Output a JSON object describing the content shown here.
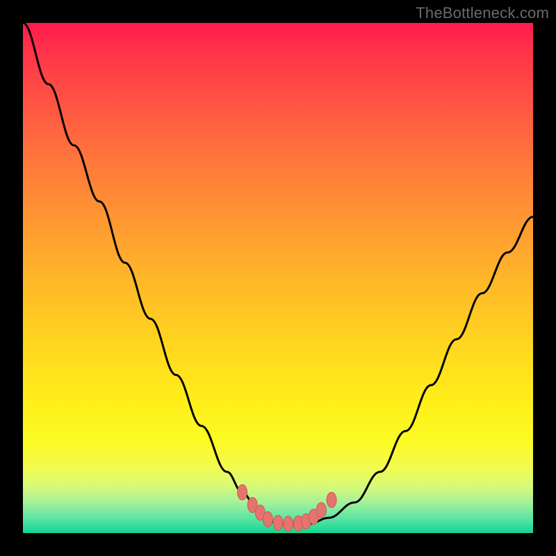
{
  "watermark": "TheBottleneck.com",
  "colors": {
    "frame": "#000000",
    "curve_stroke": "#000000",
    "marker_fill": "#e5746e",
    "marker_stroke": "#c95a54",
    "gradient_stops": [
      "#ff1a4d",
      "#ff3149",
      "#ff5543",
      "#ff7a3a",
      "#ff9b31",
      "#ffbb27",
      "#ffd81f",
      "#fff01a",
      "#fcfa24",
      "#f2fb4e",
      "#d6f97b",
      "#a4f19a",
      "#5fe5a4",
      "#11d692"
    ]
  },
  "chart_data": {
    "type": "line",
    "title": "",
    "xlabel": "",
    "ylabel": "",
    "xlim": [
      0,
      100
    ],
    "ylim": [
      0,
      100
    ],
    "grid": false,
    "legend": "none",
    "annotations": [
      "TheBottleneck.com"
    ],
    "note": "Axes unlabeled in image; x maps to horizontal position (0..100), y to vertical height above bottom (0..100). Values estimated from pixel positions.",
    "series": [
      {
        "name": "curve",
        "x": [
          0,
          5,
          10,
          15,
          20,
          25,
          30,
          35,
          40,
          43,
          46,
          48,
          50,
          52,
          54,
          56,
          60,
          65,
          70,
          75,
          80,
          85,
          90,
          95,
          100
        ],
        "y": [
          100,
          88,
          76,
          65,
          53,
          42,
          31,
          21,
          12,
          8,
          4.5,
          2.5,
          1.8,
          1.6,
          1.6,
          1.8,
          3,
          6,
          12,
          20,
          29,
          38,
          47,
          55,
          62
        ]
      }
    ],
    "markers": {
      "name": "highlight-points",
      "x": [
        43,
        45,
        46.5,
        48,
        50,
        52,
        54,
        55.5,
        57,
        58.5,
        60.5
      ],
      "y": [
        8,
        5.5,
        4,
        2.7,
        2,
        1.8,
        1.9,
        2.3,
        3.2,
        4.5,
        6.5
      ]
    }
  }
}
